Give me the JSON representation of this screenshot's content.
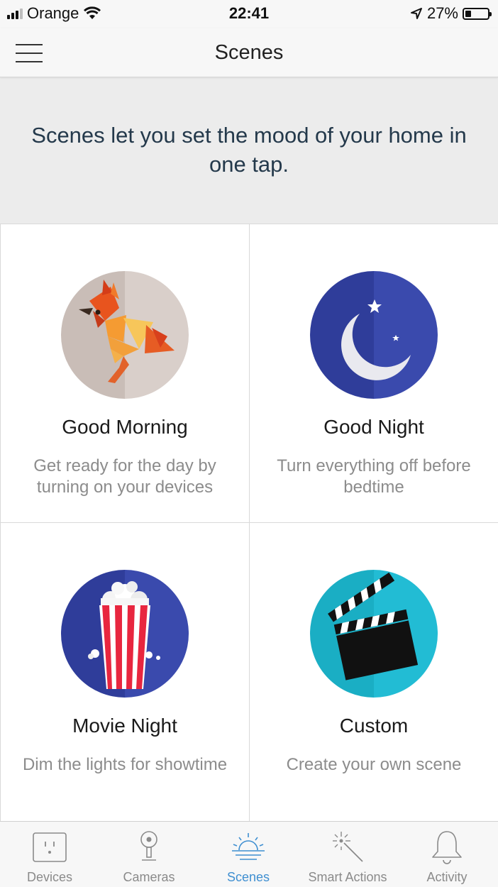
{
  "status_bar": {
    "carrier": "Orange",
    "time": "22:41",
    "battery": "27%",
    "battery_level": 0.27
  },
  "nav": {
    "title": "Scenes",
    "menu_icon": "hamburger-menu-icon"
  },
  "intro_text": "Scenes let you set the mood of your home in one tap.",
  "scenes": [
    {
      "title": "Good Morning",
      "description": "Get ready for the day by turning on your devices",
      "icon": "rooster-icon"
    },
    {
      "title": "Good Night",
      "description": "Turn everything off before bedtime",
      "icon": "moon-icon"
    },
    {
      "title": "Movie Night",
      "description": "Dim the lights for showtime",
      "icon": "popcorn-icon"
    },
    {
      "title": "Custom",
      "description": "Create your own scene",
      "icon": "clapperboard-icon"
    }
  ],
  "tabs": [
    {
      "label": "Devices",
      "icon": "outlet-icon"
    },
    {
      "label": "Cameras",
      "icon": "camera-icon"
    },
    {
      "label": "Scenes",
      "icon": "sunrise-icon"
    },
    {
      "label": "Smart Actions",
      "icon": "magic-wand-icon"
    },
    {
      "label": "Activity",
      "icon": "bell-icon"
    }
  ],
  "active_tab": "Scenes",
  "colors": {
    "accent": "#3f8fd1",
    "intro_text": "#24394b",
    "good_morning_bg": "#d6ccc7",
    "good_night_bg": "#3a4aad",
    "movie_night_bg": "#3a4aad",
    "custom_bg": "#22bcd4"
  }
}
